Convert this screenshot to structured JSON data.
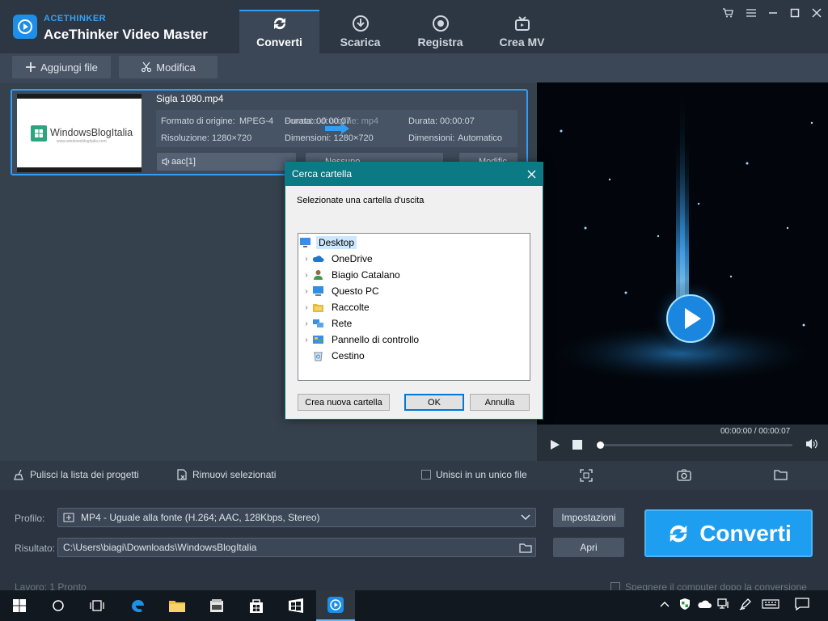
{
  "app": {
    "brand_small": "ACETHINKER",
    "title": "AceThinker Video Master"
  },
  "tabs": [
    {
      "label": "Converti",
      "icon": "refresh-icon",
      "active": true
    },
    {
      "label": "Scarica",
      "icon": "download-icon",
      "active": false
    },
    {
      "label": "Registra",
      "icon": "record-icon",
      "active": false
    },
    {
      "label": "Crea MV",
      "icon": "tv-icon",
      "active": false
    }
  ],
  "toolbar": {
    "add_files": "Aggiungi file",
    "edit": "Modifica"
  },
  "file": {
    "name": "Sigla 1080.mp4",
    "source_format_label": "Formato di origine:",
    "source_format_value": "MPEG-4",
    "source_duration_label": "Durata: 00:00:07",
    "resolution_label": "Risoluzione:",
    "resolution_value": "1280×720",
    "target_format_label": "Formato di origine: mp4",
    "target_size_label": "Dimensioni: 1280×720",
    "target_duration_label": "Durata:",
    "target_duration_value": "00:00:07",
    "target_dims_label": "Dimensioni:",
    "target_dims_value": "Automatico",
    "audio_track": "aac[1]",
    "subtitle": "Nessuno",
    "edit_short": "Modific",
    "thumb_text": "WindowsBlogItalia",
    "thumb_sub": "www.windowsblogitalia.com"
  },
  "dialog": {
    "title": "Cerca cartella",
    "instruction": "Selezionate una cartella d'uscita",
    "items": [
      {
        "label": "Desktop",
        "icon": "desktop-icon",
        "selected": true,
        "expandable": false
      },
      {
        "label": "OneDrive",
        "icon": "cloud-icon",
        "selected": false,
        "expandable": true
      },
      {
        "label": "Biagio Catalano",
        "icon": "user-icon",
        "selected": false,
        "expandable": true
      },
      {
        "label": "Questo PC",
        "icon": "computer-icon",
        "selected": false,
        "expandable": true
      },
      {
        "label": "Raccolte",
        "icon": "library-icon",
        "selected": false,
        "expandable": true
      },
      {
        "label": "Rete",
        "icon": "network-icon",
        "selected": false,
        "expandable": true
      },
      {
        "label": "Pannello di controllo",
        "icon": "control-panel-icon",
        "selected": false,
        "expandable": true
      },
      {
        "label": "Cestino",
        "icon": "recycle-bin-icon",
        "selected": false,
        "expandable": false
      }
    ],
    "new_folder": "Crea nuova cartella",
    "ok": "OK",
    "cancel": "Annulla"
  },
  "player": {
    "time": "00:00:00 / 00:00:07",
    "progress": 0
  },
  "actions": {
    "clear_list": "Pulisci la lista dei progetti",
    "remove_selected": "Rimuovi selezionati",
    "merge": "Unisci in un unico file"
  },
  "bottom": {
    "profile_label": "Profilo:",
    "profile_value": "MP4 - Uguale alla fonte (H.264; AAC, 128Kbps, Stereo)",
    "settings": "Impostazioni",
    "output_label": "Risultato:",
    "output_value": "C:\\Users\\biagi\\Downloads\\WindowsBlogItalia",
    "open": "Apri",
    "convert": "Converti",
    "status": "Lavoro: 1    Pronto",
    "shutdown": "Spegnere il computer dopo la conversione"
  },
  "colors": {
    "accent": "#1e9ef0",
    "dialog_title": "#0b7a85"
  }
}
